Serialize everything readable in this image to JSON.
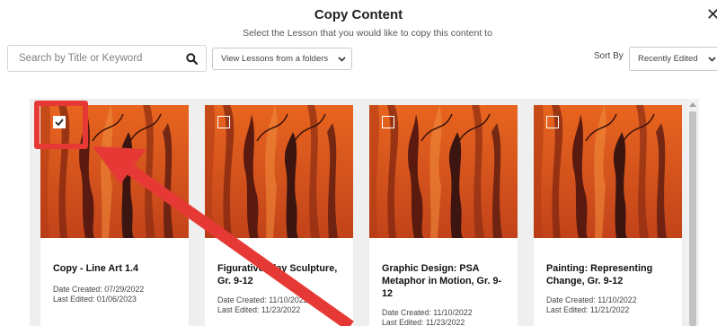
{
  "header": {
    "title": "Copy Content",
    "subtitle": "Select the Lesson that you would like to copy this content to",
    "close_glyph": "✕"
  },
  "toolbar": {
    "search_placeholder": "Search by Title or Keyword",
    "search_icon": "search-icon",
    "folder_select_value": "View Lessons from a folders",
    "sort_label": "Sort By",
    "sort_value": "Recently Edited"
  },
  "cards": [
    {
      "title": "Copy - Line Art 1.4",
      "created": "Date Created: 07/29/2022",
      "edited": "Last Edited: 01/06/2023",
      "checked": true
    },
    {
      "title": "Figurative Clay Sculpture, Gr. 9-12",
      "created": "Date Created: 11/10/2022",
      "edited": "Last Edited: 11/23/2022",
      "checked": false
    },
    {
      "title": "Graphic Design: PSA Metaphor in Motion, Gr. 9-12",
      "created": "Date Created: 11/10/2022",
      "edited": "Last Edited: 11/23/2022",
      "checked": false
    },
    {
      "title": "Painting: Representing Change, Gr. 9-12",
      "created": "Date Created: 11/10/2022",
      "edited": "Last Edited: 11/21/2022",
      "checked": false
    }
  ],
  "colors": {
    "annotation_red": "#e63935",
    "thumb_orange": "#d9531c",
    "thumb_dark": "#5a1a10"
  }
}
